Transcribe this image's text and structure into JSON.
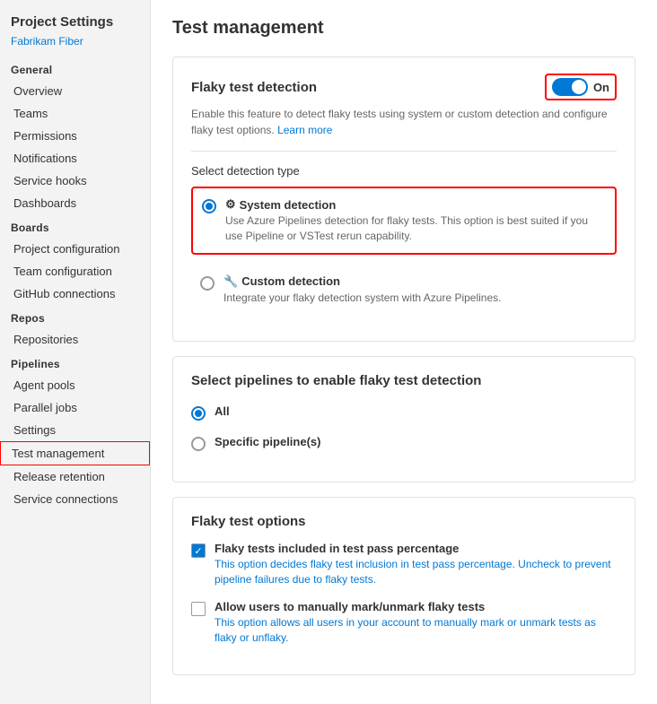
{
  "sidebar": {
    "title": "Project Settings",
    "org": "Fabrikam Fiber",
    "sections": [
      {
        "label": null,
        "items": [
          {
            "id": "overview",
            "label": "Overview",
            "active": false
          },
          {
            "id": "teams",
            "label": "Teams",
            "active": false
          },
          {
            "id": "permissions",
            "label": "Permissions",
            "active": false
          },
          {
            "id": "notifications",
            "label": "Notifications",
            "active": false
          },
          {
            "id": "service-hooks",
            "label": "Service hooks",
            "active": false
          },
          {
            "id": "dashboards",
            "label": "Dashboards",
            "active": false
          }
        ]
      },
      {
        "label": "Boards",
        "items": [
          {
            "id": "project-configuration",
            "label": "Project configuration",
            "active": false
          },
          {
            "id": "team-configuration",
            "label": "Team configuration",
            "active": false
          },
          {
            "id": "github-connections",
            "label": "GitHub connections",
            "active": false
          }
        ]
      },
      {
        "label": "Repos",
        "items": [
          {
            "id": "repositories",
            "label": "Repositories",
            "active": false
          }
        ]
      },
      {
        "label": "Pipelines",
        "items": [
          {
            "id": "agent-pools",
            "label": "Agent pools",
            "active": false
          },
          {
            "id": "parallel-jobs",
            "label": "Parallel jobs",
            "active": false
          },
          {
            "id": "settings",
            "label": "Settings",
            "active": false
          },
          {
            "id": "test-management",
            "label": "Test management",
            "active": true,
            "highlighted": true
          },
          {
            "id": "release-retention",
            "label": "Release retention",
            "active": false
          },
          {
            "id": "service-connections",
            "label": "Service connections",
            "active": false
          }
        ]
      }
    ]
  },
  "main": {
    "page_title": "Test management",
    "cards": {
      "flaky_detection": {
        "title": "Flaky test detection",
        "toggle_label": "On",
        "description": "Enable this feature to detect flaky tests using system or custom detection and configure flaky test options.",
        "learn_more": "Learn more",
        "detection_type_label": "Select detection type",
        "options": [
          {
            "id": "system",
            "title": "System detection",
            "desc": "Use Azure Pipelines detection for flaky tests. This option is best suited if you use Pipeline or VSTest rerun capability.",
            "selected": true,
            "icon": "⚙"
          },
          {
            "id": "custom",
            "title": "Custom detection",
            "desc": "Integrate your flaky detection system with Azure Pipelines.",
            "selected": false,
            "icon": "🔧"
          }
        ]
      },
      "select_pipelines": {
        "title": "Select pipelines to enable flaky test detection",
        "options": [
          {
            "id": "all",
            "label": "All",
            "selected": true
          },
          {
            "id": "specific",
            "label": "Specific pipeline(s)",
            "selected": false
          }
        ]
      },
      "flaky_options": {
        "title": "Flaky test options",
        "checkboxes": [
          {
            "id": "include-pass",
            "title": "Flaky tests included in test pass percentage",
            "desc": "This option decides flaky test inclusion in test pass percentage. Uncheck to prevent pipeline failures due to flaky tests.",
            "checked": true
          },
          {
            "id": "allow-manual",
            "title": "Allow users to manually mark/unmark flaky tests",
            "desc": "This option allows all users in your account to manually mark or unmark tests as flaky or unflaky.",
            "checked": false
          }
        ]
      }
    }
  }
}
